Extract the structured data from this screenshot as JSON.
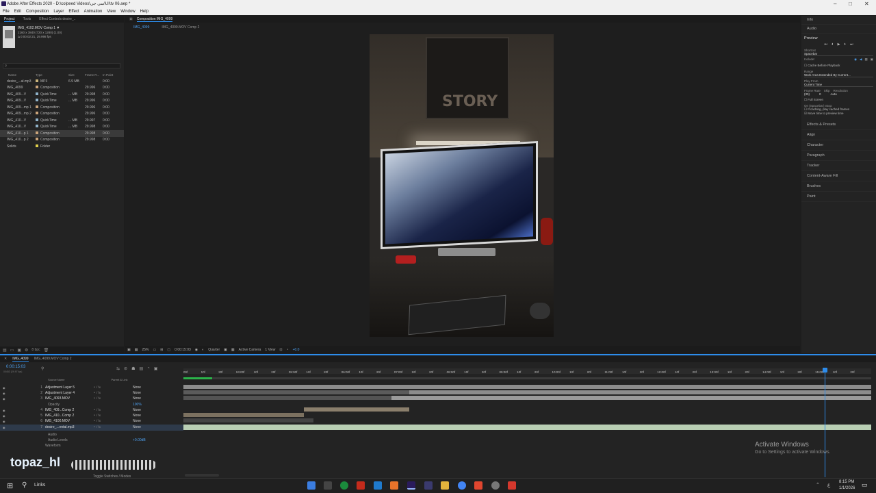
{
  "window": {
    "title": "Adobe After Effects 2020 - D:\\colpeed Videos\\سي جي\\UI\\tv 06.aep *",
    "minimize": "–",
    "maximize": "□",
    "close": "✕"
  },
  "menu": [
    "File",
    "Edit",
    "Composition",
    "Layer",
    "Effect",
    "Animation",
    "View",
    "Window",
    "Help"
  ],
  "project_panel": {
    "tabs": [
      "Project",
      "Tools",
      "Effect Controls desire_.."
    ],
    "thumb_name": "IMG_4102.MOV Comp 1 ▼",
    "thumb_info1": "2160 x 3840 (720 x 1280) (1.00)",
    "thumb_info2": "Δ 0:00:02:21, 29.998 fps",
    "search_placeholder": "ρ",
    "columns": [
      "Name",
      "Type",
      "Size",
      "Frame R...",
      "In Point"
    ],
    "items": [
      {
        "name": "desire_...al.mp3",
        "type": "MP3",
        "size": "6.9 MB",
        "fps": "",
        "in": "0:00",
        "color": "#c8b27a"
      },
      {
        "name": "IMG_4099",
        "type": "Composition",
        "size": "",
        "fps": "29.996",
        "in": "0:00",
        "color": "#c9a37a"
      },
      {
        "name": "IMG_409...V",
        "type": "QuickTime",
        "size": "... MB",
        "fps": "29.998",
        "in": "0:00",
        "color": "#8fb2c9"
      },
      {
        "name": "IMG_409...V",
        "type": "QuickTime",
        "size": "... MB",
        "fps": "29.996",
        "in": "0:00",
        "color": "#8fb2c9"
      },
      {
        "name": "IMG_409...mp 1",
        "type": "Composition",
        "size": "",
        "fps": "29.996",
        "in": "0:00",
        "color": "#c9a37a"
      },
      {
        "name": "IMG_409...mp 2",
        "type": "Composition",
        "size": "",
        "fps": "29.996",
        "in": "0:00",
        "color": "#c9a37a"
      },
      {
        "name": "IMG_410...V",
        "type": "QuickTime",
        "size": "... MB",
        "fps": "29.997",
        "in": "0:00",
        "color": "#8fb2c9"
      },
      {
        "name": "IMG_410...V",
        "type": "QuickTime",
        "size": "... MB",
        "fps": "29.998",
        "in": "0:00",
        "color": "#8fb2c9"
      },
      {
        "name": "IMG_410...p 1",
        "type": "Composition",
        "size": "",
        "fps": "29.998",
        "in": "0:00",
        "color": "#c9a37a",
        "selected": true
      },
      {
        "name": "IMG_410...p 2",
        "type": "Composition",
        "size": "",
        "fps": "29.998",
        "in": "0:00",
        "color": "#c9a37a"
      },
      {
        "name": "Solids",
        "type": "Folder",
        "size": "",
        "fps": "",
        "in": "",
        "color": "#e0d04a"
      }
    ],
    "footer_bpc": "8 bpc"
  },
  "composition_panel": {
    "header": "Composition IMG_4099",
    "tabs": [
      "IMG_4099",
      "IMG_4099.MOV Comp 2"
    ],
    "zoom": "25%",
    "timecode": "0:00:15:03",
    "resolution": "Quarter",
    "camera": "Active Camera",
    "views": "1 View",
    "exposure": "+0.0"
  },
  "right_panel": {
    "info": "Info",
    "audio": "Audio",
    "preview_title": "Preview",
    "shortcut_label": "Shortcut",
    "shortcut_value": "Spacebar",
    "include_label": "Include:",
    "cache_before": "Cache Before Playback",
    "range_label": "Range",
    "range_value": "Work Area Extended By Current...",
    "play_from_label": "Play From",
    "play_from_value": "Current Time",
    "frame_rate_label": "Frame Rate",
    "skip_label": "Skip",
    "resolution_label": "Resolution",
    "frame_rate_value": "(30)",
    "skip_value": "0",
    "resolution_value": "Auto",
    "full_screen": "Full Screen",
    "on_stop": "On (Spacebar) Stop:",
    "if_caching": "If caching, play cached frames",
    "move_time": "Move time to preview time",
    "panels": [
      "Effects & Presets",
      "Align",
      "Character",
      "Paragraph",
      "Tracker",
      "Content-Aware Fill",
      "Brushes",
      "Paint"
    ]
  },
  "timeline": {
    "tabs": [
      "IMG_4099",
      "IMG_4099.MOV Comp 2"
    ],
    "current_time": "0:00:15:03",
    "fps_info": "00453 (29.97 fps)",
    "col_source": "Source Name",
    "col_parent": "Parent & Link",
    "layers": [
      {
        "num": "1",
        "name": "Adjustment Layer 5",
        "parent": "None"
      },
      {
        "num": "2",
        "name": "Adjustment Layer 4",
        "parent": "None"
      },
      {
        "num": "3",
        "name": "IMG_4093.MOV",
        "parent": "None"
      },
      {
        "num": "",
        "name": "Opacity",
        "parent": "100%"
      },
      {
        "num": "4",
        "name": "IMG_409...Comp 2",
        "parent": "None"
      },
      {
        "num": "5",
        "name": "IMG_410...Comp 2",
        "parent": "None"
      },
      {
        "num": "6",
        "name": "IMG_4100.MOV",
        "parent": "None"
      },
      {
        "num": "7",
        "name": "desire_...ental.mp3",
        "parent": "None"
      },
      {
        "num": "",
        "name": "Audio",
        "parent": ""
      },
      {
        "num": "",
        "name": "Audio Levels",
        "parent": "+0.00dB"
      },
      {
        "num": "",
        "name": "Waveform",
        "parent": ""
      }
    ],
    "ruler": [
      "00f",
      "10f",
      "20f",
      "04:00f",
      "10f",
      "20f",
      "05:00f",
      "10f",
      "20f",
      "06:00f",
      "10f",
      "20f",
      "07:00f",
      "10f",
      "20f",
      "08:00f",
      "10f",
      "20f",
      "09:00f",
      "10f",
      "20f",
      "10:00f",
      "10f",
      "20f",
      "11:00f",
      "10f",
      "20f",
      "12:00f",
      "10f",
      "20f",
      "13:00f",
      "10f",
      "20f",
      "14:00f",
      "10f",
      "20f",
      "15:00f",
      "10f",
      "20f"
    ],
    "toggle_label": "Toggle Switches / Modes"
  },
  "overlay": {
    "brand": "topaz_hl",
    "activate_title": "Activate Windows",
    "activate_sub": "Go to Settings to activate Windows."
  },
  "taskbar": {
    "search_label": "Links",
    "time": "8:15 PM",
    "date": "1/1/2026",
    "lang": "ع"
  },
  "colors": {
    "accent": "#2d8ceb",
    "audio_layer": "#b9cfb4",
    "playhead": "#2d8ceb"
  }
}
